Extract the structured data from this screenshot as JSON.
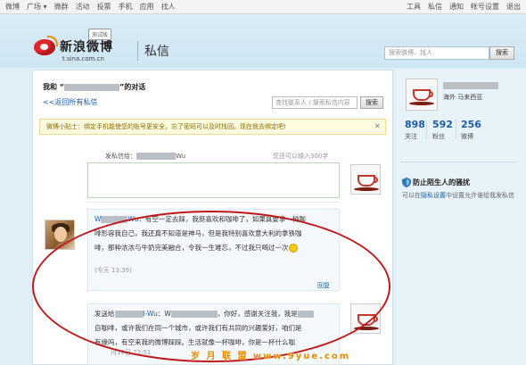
{
  "topnav": {
    "left": [
      "微博",
      "广场 ▾",
      "微群",
      "活动",
      "投票",
      "手机",
      "应用",
      "找人"
    ],
    "right": [
      "工具",
      "私信",
      "通知",
      "帐号设置",
      "退出"
    ]
  },
  "masthead": {
    "beta": "测试版",
    "logo_text": "新浪微博",
    "logo_domain": "t.sina.com.cn",
    "heading": "私信",
    "search_placeholder": "搜索微博、找人",
    "search_button": "搜索"
  },
  "conversation": {
    "title_prefix": "我和 “",
    "title_suffix": "”的对话",
    "back_link": "<<返回所有私信",
    "contact_search_placeholder": "查找联系人 / 搜索私信内容",
    "contact_search_button": "搜索",
    "tip": "微博小贴士：绑定手机能使您的账号更安全，忘了密码可以及时找回。现在就去绑定吧!",
    "tip_close": "✕",
    "compose_label": "发私信给：",
    "compose_recipient_suffix": "Wu",
    "compose_counter": "您还可以输入300字"
  },
  "messages": [
    {
      "sender_prefix": "W",
      "sender_suffix": "Wu",
      "lines": [
        "有空一定去踩，我挺喜欢和咖啡了，如果真要拿一种咖",
        "啡形容我自己，我还真不知道是神马，但是我特别喜欢意大利的拿铁咖",
        "啡，那种浓浓与牛奶完美融合，令我一生难忘，不过我只喝过一次"
      ],
      "time": "(今天  13:39)",
      "reply": "回复"
    },
    {
      "to_label": "发送给",
      "to_suffix": "l-Wu",
      "sender_prefix": "W",
      "lines": [
        "，你好，感谢关注我，我是",
        "自咖啡，或许我们在同一个城市，或许我们有共同的兴趣爱好，咱们是",
        "有缘吗，有空来我的微博踩踩。生活就像一杯咖啡，你是一杯什么咖"
      ],
      "time": "月16日  22:51"
    }
  ],
  "sidebar": {
    "location": "海外  马来西亚",
    "stats": [
      {
        "num": "898",
        "label": "关注"
      },
      {
        "num": "592",
        "label": "粉丝"
      },
      {
        "num": "256",
        "label": "微博"
      }
    ],
    "privacy_title": "防止陌生人的骚扰",
    "privacy_desc_1": "可以在",
    "privacy_desc_link": "隐私设置",
    "privacy_desc_2": "中设置允许谁给我发私信"
  },
  "watermark": "岁 月 联 盟  www.9yue.com"
}
